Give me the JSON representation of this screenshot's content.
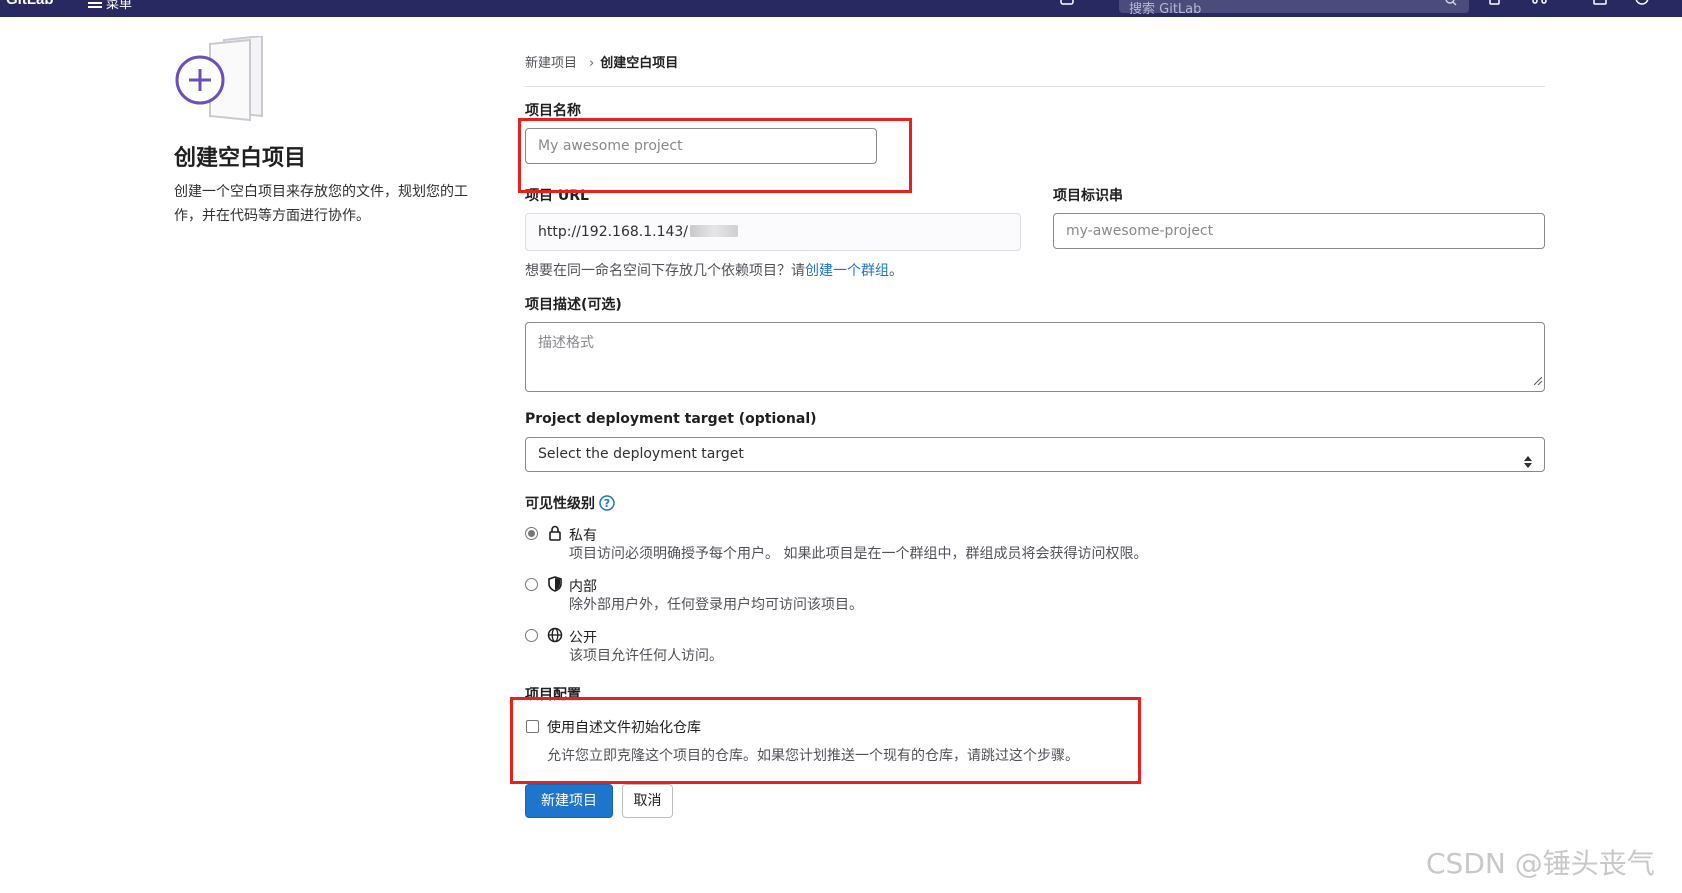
{
  "navbar": {
    "brand": "GitLab",
    "menu_label": "菜单",
    "search_placeholder": "搜索 GitLab"
  },
  "intro": {
    "title": "创建空白项目",
    "description": "创建一个空白项目来存放您的文件，规划您的工作，并在代码等方面进行协作。"
  },
  "breadcrumb": {
    "parent": "新建项目",
    "separator": "›",
    "current": "创建空白项目"
  },
  "form": {
    "project_name": {
      "label": "项目名称",
      "placeholder": "My awesome project"
    },
    "project_url": {
      "label": "项目 URL",
      "value": "http://192.168.1.143/"
    },
    "project_slug": {
      "label": "项目标识串",
      "placeholder": "my-awesome-project"
    },
    "group_hint": {
      "prefix": "想要在同一命名空间下存放几个依赖项目？请",
      "link": "创建一个群组",
      "suffix": "。"
    },
    "description": {
      "label": "项目描述(可选)",
      "placeholder": "描述格式"
    },
    "deployment": {
      "label": "Project deployment target (optional)",
      "selected": "Select the deployment target"
    },
    "visibility": {
      "label": "可见性级别",
      "options": [
        {
          "title": "私有",
          "desc": "项目访问必须明确授予每个用户。 如果此项目是在一个群组中，群组成员将会获得访问权限。",
          "checked": true,
          "icon": "lock-icon"
        },
        {
          "title": "内部",
          "desc": "除外部用户外，任何登录用户均可访问该项目。",
          "checked": false,
          "icon": "shield-icon"
        },
        {
          "title": "公开",
          "desc": "该项目允许任何人访问。",
          "checked": false,
          "icon": "globe-icon"
        }
      ]
    },
    "config": {
      "label": "项目配置",
      "readme_label": "使用自述文件初始化仓库",
      "readme_help": "允许您立即克隆这个项目的仓库。如果您计划推送一个现有的仓库，请跳过这个步骤。",
      "readme_checked": false
    },
    "buttons": {
      "create": "新建项目",
      "cancel": "取消"
    }
  },
  "colors": {
    "navbar": "#292961",
    "primary": "#1f75cb",
    "annotation": "#e8211f",
    "illustration": "#6b4fbb"
  },
  "watermark": "CSDN @锤头丧气"
}
